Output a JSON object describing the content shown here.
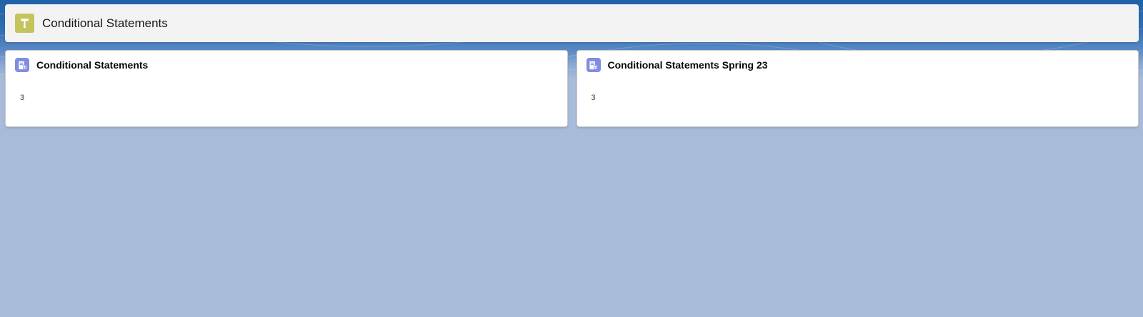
{
  "page": {
    "title": "Conditional Statements",
    "icon": "hammer-icon",
    "icon_color": "#c3c45b"
  },
  "cards": [
    {
      "icon": "report-icon",
      "title": "Conditional Statements",
      "value": "3"
    },
    {
      "icon": "report-icon",
      "title": "Conditional Statements Spring 23",
      "value": "3"
    }
  ],
  "colors": {
    "background_top": "#1f62a8",
    "background_bottom": "#a8bbd9",
    "card_icon": "#7f8de1"
  }
}
